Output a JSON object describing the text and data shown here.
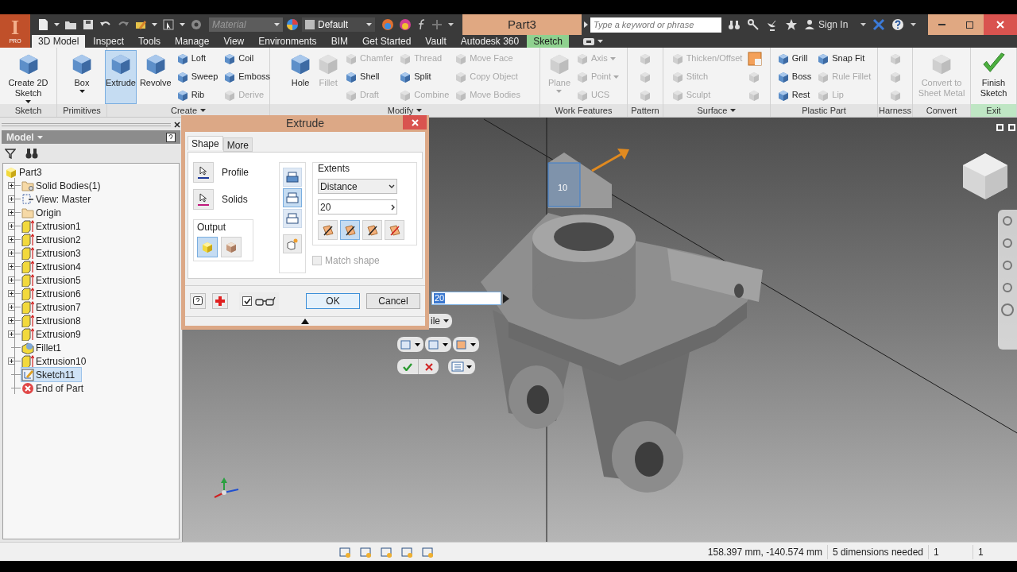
{
  "app": {
    "logo": "I",
    "edition": "PRO"
  },
  "quick_access": {
    "material": {
      "placeholder": "Material"
    },
    "appearance": {
      "value": "Default"
    }
  },
  "window": {
    "title": "Part3"
  },
  "search": {
    "placeholder": "Type a keyword or phrase"
  },
  "account": {
    "sign_in": "Sign In"
  },
  "ribbon_tabs": [
    {
      "label": "3D Model",
      "selected": true,
      "kind": "normal"
    },
    {
      "label": "Inspect",
      "selected": false,
      "kind": "normal"
    },
    {
      "label": "Tools",
      "selected": false,
      "kind": "normal"
    },
    {
      "label": "Manage",
      "selected": false,
      "kind": "normal"
    },
    {
      "label": "View",
      "selected": false,
      "kind": "normal"
    },
    {
      "label": "Environments",
      "selected": false,
      "kind": "normal"
    },
    {
      "label": "BIM",
      "selected": false,
      "kind": "normal"
    },
    {
      "label": "Get Started",
      "selected": false,
      "kind": "normal"
    },
    {
      "label": "Vault",
      "selected": false,
      "kind": "normal"
    },
    {
      "label": "Autodesk 360",
      "selected": false,
      "kind": "normal"
    },
    {
      "label": "Sketch",
      "selected": false,
      "kind": "contextual"
    }
  ],
  "ribbon_panels": [
    {
      "title": "Sketch",
      "menu": false,
      "highlighted": false,
      "tools": [
        {
          "label": "Create 2D Sketch",
          "kind": "large",
          "disabled": false,
          "selected": false,
          "dropdown": true
        }
      ]
    },
    {
      "title": "Primitives",
      "menu": false,
      "highlighted": false,
      "tools": [
        {
          "label": "Box",
          "kind": "large",
          "disabled": false,
          "selected": false,
          "dropdown": true
        }
      ]
    },
    {
      "title": "Create",
      "menu": true,
      "highlighted": false,
      "tools": [
        {
          "label": "Extrude",
          "kind": "large",
          "disabled": false,
          "selected": true,
          "dropdown": false
        },
        {
          "label": "Revolve",
          "kind": "large",
          "disabled": false,
          "selected": false,
          "dropdown": false
        },
        {
          "label": "Loft",
          "kind": "small",
          "disabled": false,
          "selected": false,
          "dropdown": false
        },
        {
          "label": "Sweep",
          "kind": "small",
          "disabled": false,
          "selected": false,
          "dropdown": false
        },
        {
          "label": "Rib",
          "kind": "small",
          "disabled": false,
          "selected": false,
          "dropdown": false
        },
        {
          "label": "Coil",
          "kind": "small",
          "disabled": false,
          "selected": false,
          "dropdown": false
        },
        {
          "label": "Emboss",
          "kind": "small",
          "disabled": false,
          "selected": false,
          "dropdown": false
        },
        {
          "label": "Derive",
          "kind": "small",
          "disabled": true,
          "selected": false,
          "dropdown": false
        }
      ]
    },
    {
      "title": "Modify",
      "menu": true,
      "highlighted": false,
      "tools": [
        {
          "label": "Hole",
          "kind": "large",
          "disabled": false,
          "selected": false,
          "dropdown": false
        },
        {
          "label": "Fillet",
          "kind": "large",
          "disabled": true,
          "selected": false,
          "dropdown": false
        },
        {
          "label": "Chamfer",
          "kind": "small",
          "disabled": true,
          "selected": false,
          "dropdown": false
        },
        {
          "label": "Shell",
          "kind": "small",
          "disabled": false,
          "selected": false,
          "dropdown": false
        },
        {
          "label": "Draft",
          "kind": "small",
          "disabled": true,
          "selected": false,
          "dropdown": false
        },
        {
          "label": "Thread",
          "kind": "small",
          "disabled": true,
          "selected": false,
          "dropdown": false
        },
        {
          "label": "Split",
          "kind": "small",
          "disabled": false,
          "selected": false,
          "dropdown": false
        },
        {
          "label": "Combine",
          "kind": "small",
          "disabled": true,
          "selected": false,
          "dropdown": false
        },
        {
          "label": "Move Face",
          "kind": "small",
          "disabled": true,
          "selected": false,
          "dropdown": false
        },
        {
          "label": "Copy Object",
          "kind": "small",
          "disabled": true,
          "selected": false,
          "dropdown": false
        },
        {
          "label": "Move Bodies",
          "kind": "small",
          "disabled": true,
          "selected": false,
          "dropdown": false
        }
      ]
    },
    {
      "title": "Work Features",
      "menu": false,
      "highlighted": false,
      "tools": [
        {
          "label": "Plane",
          "kind": "large",
          "disabled": true,
          "selected": false,
          "dropdown": true
        },
        {
          "label": "Axis",
          "kind": "small",
          "disabled": true,
          "selected": false,
          "dropdown": true
        },
        {
          "label": "Point",
          "kind": "small",
          "disabled": true,
          "selected": false,
          "dropdown": true
        },
        {
          "label": "UCS",
          "kind": "small",
          "disabled": true,
          "selected": false,
          "dropdown": false
        }
      ]
    },
    {
      "title": "Pattern",
      "menu": false,
      "highlighted": false,
      "tools": [
        {
          "kind": "icon",
          "disabled": true,
          "selected": false,
          "dropdown": false
        },
        {
          "kind": "icon",
          "disabled": true,
          "selected": false,
          "dropdown": false
        },
        {
          "kind": "icon",
          "disabled": true,
          "selected": false,
          "dropdown": false
        }
      ]
    },
    {
      "title": "Surface",
      "menu": true,
      "highlighted": false,
      "tools": [
        {
          "label": "Thicken/Offset",
          "kind": "small",
          "disabled": true,
          "selected": false,
          "dropdown": false
        },
        {
          "label": "Stitch",
          "kind": "small",
          "disabled": true,
          "selected": false,
          "dropdown": false
        },
        {
          "label": "Sculpt",
          "kind": "small",
          "disabled": true,
          "selected": false,
          "dropdown": false
        },
        {
          "kind": "icon",
          "disabled": false,
          "selected": false,
          "dropdown": false
        },
        {
          "kind": "icon",
          "disabled": true,
          "selected": false,
          "dropdown": false
        },
        {
          "kind": "icon",
          "disabled": true,
          "selected": false,
          "dropdown": false
        }
      ]
    },
    {
      "title": "Plastic Part",
      "menu": false,
      "highlighted": false,
      "tools": [
        {
          "label": "Grill",
          "kind": "small",
          "disabled": false,
          "selected": false,
          "dropdown": false
        },
        {
          "label": "Boss",
          "kind": "small",
          "disabled": false,
          "selected": false,
          "dropdown": false
        },
        {
          "label": "Rest",
          "kind": "small",
          "disabled": false,
          "selected": false,
          "dropdown": false
        },
        {
          "label": "Snap Fit",
          "kind": "small",
          "disabled": false,
          "selected": false,
          "dropdown": false
        },
        {
          "label": "Rule Fillet",
          "kind": "small",
          "disabled": true,
          "selected": false,
          "dropdown": false
        },
        {
          "label": "Lip",
          "kind": "small",
          "disabled": true,
          "selected": false,
          "dropdown": false
        }
      ]
    },
    {
      "title": "Harness",
      "menu": false,
      "highlighted": false,
      "tools": [
        {
          "kind": "icon",
          "disabled": true,
          "selected": false,
          "dropdown": false
        },
        {
          "kind": "icon",
          "disabled": true,
          "selected": false,
          "dropdown": false
        },
        {
          "kind": "icon",
          "disabled": true,
          "selected": false,
          "dropdown": false
        }
      ]
    },
    {
      "title": "Convert",
      "menu": false,
      "highlighted": false,
      "tools": [
        {
          "label": "Convert to Sheet Metal",
          "kind": "large",
          "disabled": true,
          "selected": false,
          "dropdown": false
        }
      ]
    },
    {
      "title": "Exit",
      "menu": false,
      "highlighted": true,
      "tools": [
        {
          "label": "Finish Sketch",
          "kind": "large",
          "disabled": false,
          "selected": false,
          "dropdown": false
        }
      ]
    }
  ],
  "browser": {
    "title": "Model",
    "tree": [
      {
        "label": "Part3",
        "kind": "part",
        "expandable": false,
        "selected": false,
        "children": [
          {
            "label": "Solid Bodies(1)",
            "kind": "bodies",
            "expandable": true,
            "selected": false
          },
          {
            "label": "View: Master",
            "kind": "view",
            "expandable": true,
            "selected": false
          },
          {
            "label": "Origin",
            "kind": "folder",
            "expandable": true,
            "selected": false
          },
          {
            "label": "Extrusion1",
            "kind": "extrusion",
            "expandable": true,
            "selected": false
          },
          {
            "label": "Extrusion2",
            "kind": "extrusion",
            "expandable": true,
            "selected": false
          },
          {
            "label": "Extrusion3",
            "kind": "extrusion",
            "expandable": true,
            "selected": false
          },
          {
            "label": "Extrusion4",
            "kind": "extrusion",
            "expandable": true,
            "selected": false
          },
          {
            "label": "Extrusion5",
            "kind": "extrusion",
            "expandable": true,
            "selected": false
          },
          {
            "label": "Extrusion6",
            "kind": "extrusion",
            "expandable": true,
            "selected": false
          },
          {
            "label": "Extrusion7",
            "kind": "extrusion",
            "expandable": true,
            "selected": false
          },
          {
            "label": "Extrusion8",
            "kind": "extrusion",
            "expandable": true,
            "selected": false
          },
          {
            "label": "Extrusion9",
            "kind": "extrusion",
            "expandable": true,
            "selected": false
          },
          {
            "label": "Fillet1",
            "kind": "fillet",
            "expandable": false,
            "selected": false
          },
          {
            "label": "Extrusion10",
            "kind": "extrusion",
            "expandable": true,
            "selected": false
          },
          {
            "label": "Sketch11",
            "kind": "sketch",
            "expandable": false,
            "selected": true
          },
          {
            "label": "End of Part",
            "kind": "end",
            "expandable": false,
            "selected": false
          }
        ]
      }
    ]
  },
  "dialog": {
    "title": "Extrude",
    "tabs": [
      {
        "label": "Shape",
        "selected": true
      },
      {
        "label": "More",
        "selected": false
      }
    ],
    "selectors": [
      {
        "label": "Profile",
        "color": "#1f3a9a"
      },
      {
        "label": "Solids",
        "color": "#c0187c"
      }
    ],
    "output": {
      "label": "Output",
      "options": [
        {
          "selected": true
        },
        {
          "selected": false
        }
      ]
    },
    "operations": [
      {
        "selected": false
      },
      {
        "selected": true
      },
      {
        "selected": false
      }
    ],
    "extents": {
      "label": "Extents",
      "method": "Distance",
      "distance": "20",
      "directions": [
        {
          "selected": false
        },
        {
          "selected": true
        },
        {
          "selected": false
        },
        {
          "selected": false
        }
      ]
    },
    "match_shape": {
      "label": "Match shape",
      "checked": false,
      "disabled": true
    },
    "preview": {
      "checked": true
    },
    "buttons": [
      "OK",
      "Cancel"
    ]
  },
  "viewport": {
    "value_input": "20",
    "profile_menu": "ile",
    "dimension": "10"
  },
  "status_bar": {
    "coordinates": "158.397 mm, -140.574 mm",
    "message": "5 dimensions needed",
    "counts": [
      "1",
      "1"
    ]
  }
}
